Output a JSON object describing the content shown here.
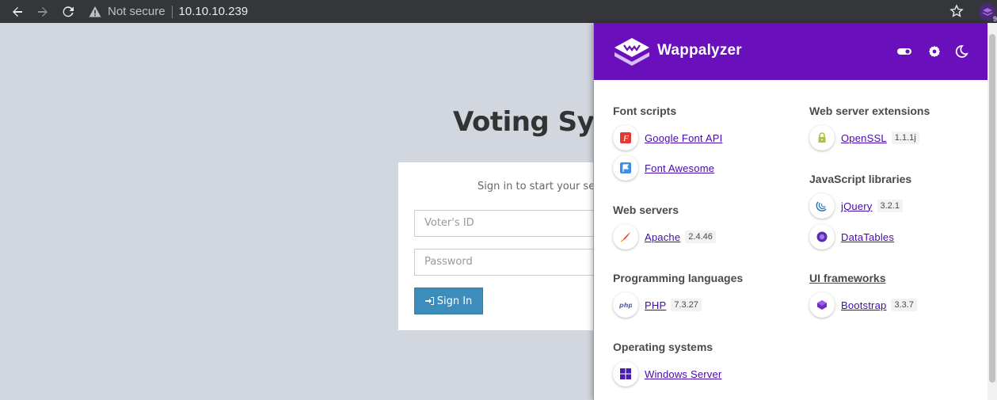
{
  "browser": {
    "security_label": "Not secure",
    "url": "10.10.10.239",
    "extension_badge": "9"
  },
  "page": {
    "title": "Voting System",
    "login_message": "Sign in to start your session",
    "voter_id_placeholder": "Voter's ID",
    "password_placeholder": "Password",
    "sign_in_label": "Sign In"
  },
  "wappalyzer": {
    "title": "Wappalyzer",
    "brand_color": "#6a0fbc",
    "link_color": "#4608ad",
    "categories": {
      "font_scripts": {
        "label": "Font scripts",
        "items": [
          {
            "name": "Google Font API",
            "icon": "google-font-api-icon"
          },
          {
            "name": "Font Awesome",
            "icon": "font-awesome-icon"
          }
        ]
      },
      "web_servers": {
        "label": "Web servers",
        "items": [
          {
            "name": "Apache",
            "version": "2.4.46",
            "icon": "apache-feather-icon"
          }
        ]
      },
      "programming_languages": {
        "label": "Programming languages",
        "items": [
          {
            "name": "PHP",
            "version": "7.3.27",
            "icon": "php-icon"
          }
        ]
      },
      "operating_systems": {
        "label": "Operating systems",
        "items": [
          {
            "name": "Windows Server",
            "icon": "windows-icon"
          }
        ]
      },
      "web_server_extensions": {
        "label": "Web server extensions",
        "items": [
          {
            "name": "OpenSSL",
            "version": "1.1.1j",
            "icon": "lock-icon"
          }
        ]
      },
      "javascript_libraries": {
        "label": "JavaScript libraries",
        "items": [
          {
            "name": "jQuery",
            "version": "3.2.1",
            "icon": "jquery-icon"
          },
          {
            "name": "DataTables",
            "icon": "datatables-icon"
          }
        ]
      },
      "ui_frameworks": {
        "label": "UI frameworks",
        "items": [
          {
            "name": "Bootstrap",
            "version": "3.3.7",
            "icon": "bootstrap-icon"
          }
        ]
      }
    }
  }
}
